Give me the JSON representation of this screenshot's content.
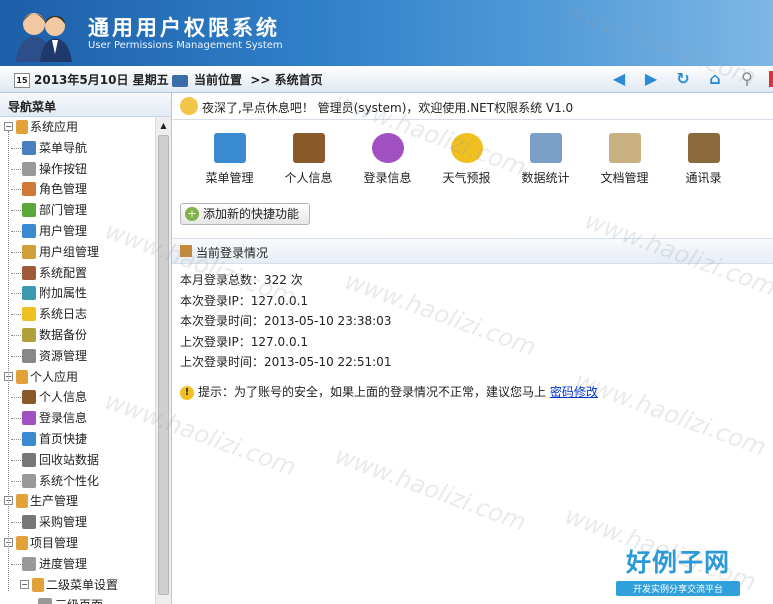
{
  "header": {
    "title_cn": "通用用户权限系统",
    "title_en": "User Permissions Management System"
  },
  "infobar": {
    "calendar_day": "15",
    "date": "2013年5月10日 星期五",
    "location_label": "当前位置",
    "location_path": ">> 系统首页"
  },
  "sidebar": {
    "title": "导航菜单"
  },
  "tree": [
    {
      "label": "系统应用",
      "level": 0,
      "type": "folder",
      "color": "#e2a23a"
    },
    {
      "label": "菜单导航",
      "level": 1,
      "type": "item",
      "color": "#4a7fc0"
    },
    {
      "label": "操作按钮",
      "level": 1,
      "type": "item",
      "color": "#999999"
    },
    {
      "label": "角色管理",
      "level": 1,
      "type": "item",
      "color": "#d07a3a"
    },
    {
      "label": "部门管理",
      "level": 1,
      "type": "item",
      "color": "#5aa83a"
    },
    {
      "label": "用户管理",
      "level": 1,
      "type": "item",
      "color": "#3a8ad0"
    },
    {
      "label": "用户组管理",
      "level": 1,
      "type": "item",
      "color": "#d0a03a"
    },
    {
      "label": "系统配置",
      "level": 1,
      "type": "item",
      "color": "#a05a3a"
    },
    {
      "label": "附加属性",
      "level": 1,
      "type": "item",
      "color": "#3a9ab0"
    },
    {
      "label": "系统日志",
      "level": 1,
      "type": "item",
      "color": "#f0c020"
    },
    {
      "label": "数据备份",
      "level": 1,
      "type": "item",
      "color": "#b0a03a"
    },
    {
      "label": "资源管理",
      "level": 1,
      "type": "item",
      "color": "#888888"
    },
    {
      "label": "个人应用",
      "level": 0,
      "type": "folder",
      "color": "#e2a23a"
    },
    {
      "label": "个人信息",
      "level": 1,
      "type": "item",
      "color": "#8a5a2a"
    },
    {
      "label": "登录信息",
      "level": 1,
      "type": "item",
      "color": "#a050c0"
    },
    {
      "label": "首页快捷",
      "level": 1,
      "type": "item",
      "color": "#3a8ad0"
    },
    {
      "label": "回收站数据",
      "level": 1,
      "type": "item",
      "color": "#777777"
    },
    {
      "label": "系统个性化",
      "level": 1,
      "type": "item",
      "color": "#999999"
    },
    {
      "label": "生产管理",
      "level": 0,
      "type": "folder",
      "color": "#e2a23a"
    },
    {
      "label": "采购管理",
      "level": 1,
      "type": "item",
      "color": "#777777"
    },
    {
      "label": "项目管理",
      "level": 0,
      "type": "folder",
      "color": "#e2a23a"
    },
    {
      "label": "进度管理",
      "level": 1,
      "type": "item",
      "color": "#999999"
    },
    {
      "label": "二级菜单设置",
      "level": 1,
      "type": "folder",
      "color": "#e2a23a"
    },
    {
      "label": "三级页面",
      "level": 2,
      "type": "item",
      "color": "#999999"
    }
  ],
  "greeting": "夜深了,早点休息吧！ 管理员(system)，欢迎使用.NET权限系统 V1.0",
  "apps": [
    {
      "label": "菜单管理",
      "icon": "sitemap-icon",
      "color": "#3a8ad0"
    },
    {
      "label": "个人信息",
      "icon": "briefcase-icon",
      "color": "#8a5a2a"
    },
    {
      "label": "登录信息",
      "icon": "lightbulb-icon",
      "color": "#a050c0"
    },
    {
      "label": "天气预报",
      "icon": "weather-icon",
      "color": "#f0c020"
    },
    {
      "label": "数据统计",
      "icon": "chart-icon",
      "color": "#7aa0c8"
    },
    {
      "label": "文档管理",
      "icon": "folder-icon",
      "color": "#c8b080"
    },
    {
      "label": "通讯录",
      "icon": "contacts-icon",
      "color": "#8a6a3a"
    }
  ],
  "add_shortcut": "添加新的快捷功能",
  "login_panel": {
    "title": "当前登录情况",
    "lines": [
      "本月登录总数：322 次",
      "本次登录IP：127.0.0.1",
      "本次登录时间：2013-05-10 23:38:03",
      "上次登录IP：127.0.0.1",
      "上次登录时间：2013-05-10 22:51:01"
    ],
    "tip": "提示：为了账号的安全，如果上面的登录情况不正常，建议您马上",
    "tip_link": "密码修改"
  },
  "watermark": "www.haolizi.com",
  "brand": {
    "big": "好例子网",
    "small": "开发实例分享交流平台"
  }
}
